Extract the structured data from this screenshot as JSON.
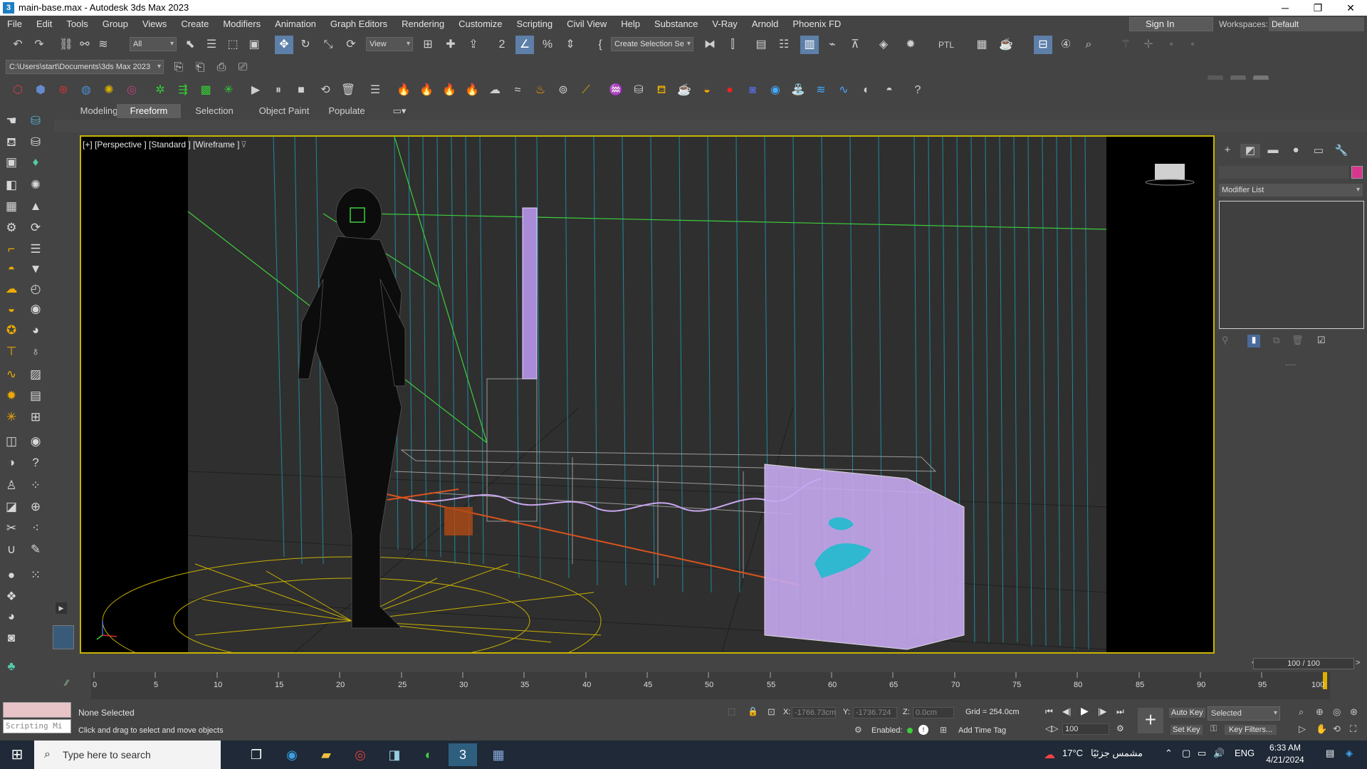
{
  "window": {
    "title": "main-base.max - Autodesk 3ds Max 2023",
    "buttons": {
      "minimize": "─",
      "restore": "❐",
      "close": "✕"
    }
  },
  "menu": [
    "File",
    "Edit",
    "Tools",
    "Group",
    "Views",
    "Create",
    "Modifiers",
    "Animation",
    "Graph Editors",
    "Rendering",
    "Customize",
    "Scripting",
    "Civil View",
    "Help",
    "Substance",
    "V-Ray",
    "Arnold",
    "Phoenix FD"
  ],
  "account": {
    "signin": "Sign In",
    "workspaces_label": "Workspaces:",
    "workspaces_value": "Default"
  },
  "toolbar": {
    "filter_dropdown": "All",
    "view_dropdown": "View",
    "selection_set": "Create Selection Se",
    "ptl_label": "PTL",
    "project_path": "C:\\Users\\start\\Documents\\3ds Max 2023"
  },
  "ribbon": {
    "tabs": [
      "Modeling",
      "Freeform",
      "Selection",
      "Object Paint",
      "Populate"
    ],
    "active": "Freeform"
  },
  "viewport": {
    "label": "[+] [Perspective ] [Standard ] [Wireframe ]"
  },
  "command_panel": {
    "modifier_list": "Modifier List",
    "color_accent": "#d8368e"
  },
  "timeline": {
    "frame_display": "100 / 100",
    "ticks": [
      "0",
      "5",
      "10",
      "15",
      "20",
      "25",
      "30",
      "35",
      "40",
      "45",
      "50",
      "55",
      "60",
      "65",
      "70",
      "75",
      "80",
      "85",
      "90",
      "95",
      "100"
    ]
  },
  "status": {
    "selection": "None Selected",
    "prompt": "Click and drag to select and move objects",
    "script_label": "Scripting Mi",
    "x_label": "X:",
    "x_value": "-1766.73cm",
    "y_label": "Y:",
    "y_value": "-1736.724",
    "z_label": "Z:",
    "z_value": "0.0cm",
    "grid": "Grid = 254.0cm",
    "enabled_label": "Enabled:",
    "add_time_tag": "Add Time Tag",
    "auto_key": "Auto Key",
    "selected_dropdown": "Selected",
    "set_key": "Set Key",
    "key_filters": "Key Filters...",
    "frame_field": "100"
  },
  "taskbar": {
    "search_placeholder": "Type here to search",
    "weather": "17°C",
    "weather_text": "مشمس جزئيًا",
    "language": "ENG",
    "time": "6:33 AM",
    "date": "4/21/2024"
  }
}
